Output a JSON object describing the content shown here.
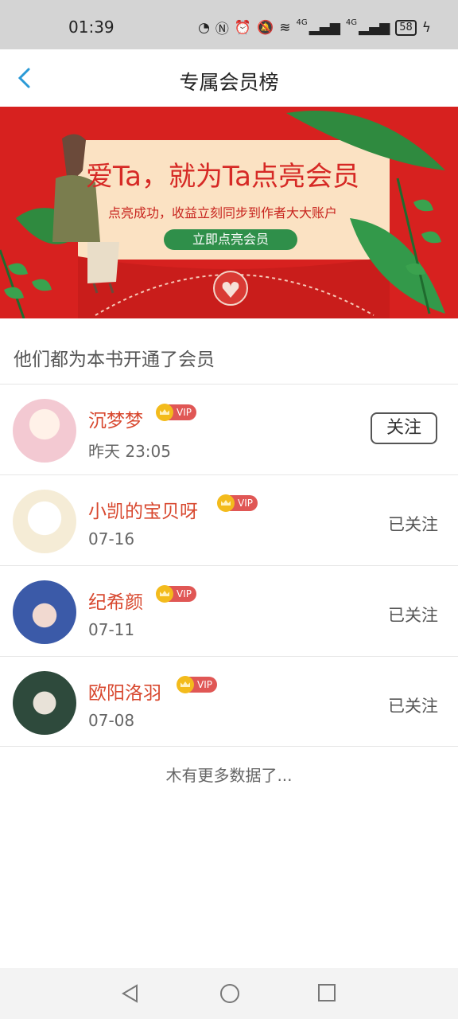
{
  "status_bar": {
    "time": "01:39",
    "net1": "4G",
    "net2": "4G",
    "battery": "58"
  },
  "header": {
    "title": "专属会员榜"
  },
  "banner": {
    "headline": "爱Ta，就为Ta点亮会员",
    "subtitle": "点亮成功，收益立刻同步到作者大大账户",
    "cta_label": "立即点亮会员",
    "accent_color": "#d7211f",
    "button_color": "#2f8f4a"
  },
  "section_title": "他们都为本书开通了会员",
  "members": [
    {
      "name": "沉梦梦",
      "vip": "VIP",
      "date": "昨天 23:05",
      "follow": "关注",
      "followed": false,
      "avatar_color": "#f3c9d2"
    },
    {
      "name": "小凯的宝贝呀",
      "vip": "VIP",
      "date": "07-16",
      "follow": "已关注",
      "followed": true,
      "avatar_color": "#f5ecd6"
    },
    {
      "name": "纪希颜",
      "vip": "VIP",
      "date": "07-11",
      "follow": "已关注",
      "followed": true,
      "avatar_color": "#3b5aa8"
    },
    {
      "name": "欧阳洛羽",
      "vip": "VIP",
      "date": "07-08",
      "follow": "已关注",
      "followed": true,
      "avatar_color": "#2e4a3c"
    }
  ],
  "footer_text": "木有更多数据了..."
}
